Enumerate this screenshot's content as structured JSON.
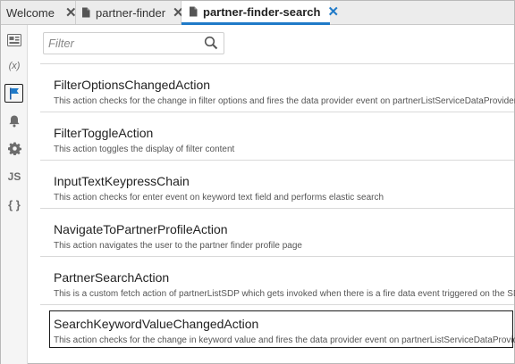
{
  "tabs": [
    {
      "label": "Welcome",
      "active": false
    },
    {
      "label": "partner-finder",
      "active": false
    },
    {
      "label": "partner-finder-search",
      "active": true
    }
  ],
  "sidebar": {
    "items": [
      {
        "icon": "components-icon"
      },
      {
        "icon": "variables-icon",
        "glyph": "(x)"
      },
      {
        "icon": "actions-flag-icon",
        "active": true
      },
      {
        "icon": "events-bell-icon"
      },
      {
        "icon": "settings-gear-icon"
      },
      {
        "icon": "javascript-icon",
        "glyph": "JS"
      },
      {
        "icon": "json-braces-icon",
        "glyph": "{ }"
      }
    ]
  },
  "filter": {
    "placeholder": "Filter",
    "value": ""
  },
  "actions": [
    {
      "title": "FilterOptionsChangedAction",
      "description": "This action checks for the change in filter options and fires the data provider event on partnerListServiceDataProvider"
    },
    {
      "title": "FilterToggleAction",
      "description": "This action toggles the display of filter content"
    },
    {
      "title": "InputTextKeypressChain",
      "description": "This action checks for enter event on keyword text field and performs elastic search"
    },
    {
      "title": "NavigateToPartnerProfileAction",
      "description": "This action navigates the user to the partner finder profile page"
    },
    {
      "title": "PartnerSearchAction",
      "description": "This is a custom fetch action of partnerListSDP which gets invoked when there is a fire data event triggered on the SDP"
    },
    {
      "title": "SearchKeywordValueChangedAction",
      "description": "This action checks for the change in keyword value and fires the data provider event on partnerListServiceDataProvider",
      "selected": true
    }
  ],
  "colors": {
    "accent": "#1f7ac8",
    "selected_border": "#1a1a1a"
  }
}
